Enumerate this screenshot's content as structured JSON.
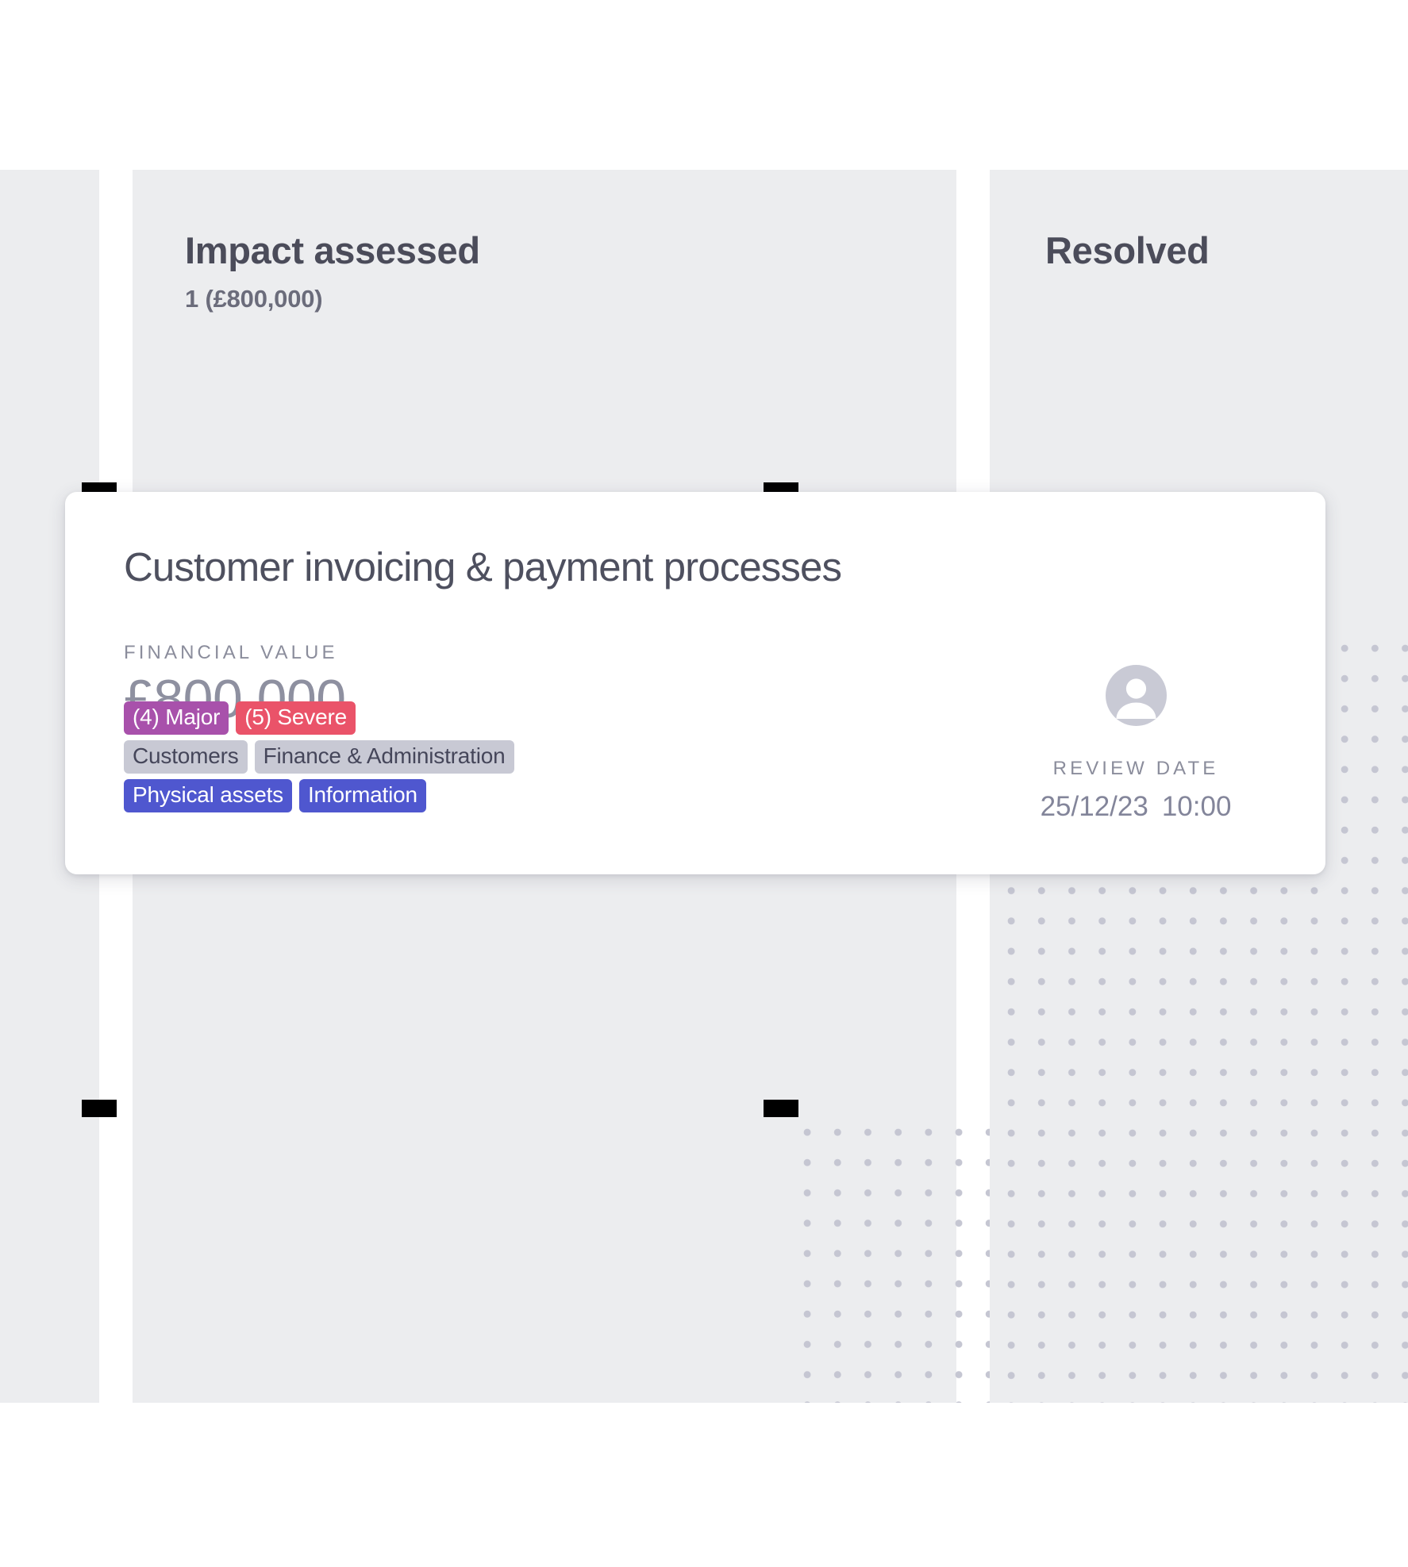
{
  "board": {
    "columns": [
      {
        "id": "impact-assessed",
        "title": "Impact assessed",
        "subtitle": "1 (£800,000)"
      },
      {
        "id": "resolved",
        "title": "Resolved",
        "subtitle": ""
      }
    ]
  },
  "card": {
    "title": "Customer invoicing & payment processes",
    "financial": {
      "label": "FINANCIAL VALUE",
      "value": "£800,000"
    },
    "chips": {
      "row1": [
        {
          "text": "(4) Major",
          "style": "impact"
        },
        {
          "text": "(5) Severe",
          "style": "severity"
        }
      ],
      "row2": [
        {
          "text": "Customers",
          "style": "neutral"
        },
        {
          "text": "Finance & Administration",
          "style": "neutral"
        }
      ],
      "row3": [
        {
          "text": "Physical assets",
          "style": "category"
        },
        {
          "text": "Information",
          "style": "category"
        }
      ]
    },
    "review": {
      "label": "REVIEW DATE",
      "date": "25/12/23",
      "time": "10:00"
    },
    "avatar_icon": "user-avatar-icon"
  },
  "colors": {
    "column_bg": "#ecedef",
    "card_bg": "#ffffff",
    "title_text": "#4b4c5a",
    "muted_text": "#8b8d9c",
    "value_text": "#8e90a0",
    "chip_impact": "#a851ab",
    "chip_severity": "#ea5369",
    "chip_neutral": "#c8c9d4",
    "chip_category": "#4f57cf",
    "dot_pattern": "#c5c6d2",
    "drag_marker": "#000000"
  }
}
